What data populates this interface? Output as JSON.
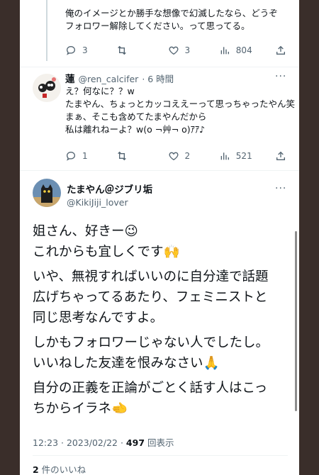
{
  "prev_tweet": {
    "text_lines": [
      "俺のイメージとか勝手な想像で幻滅したなら、どうぞ",
      "フォロワー解除してください。って思ってる。"
    ],
    "actions": {
      "replies": "3",
      "retweets": "",
      "likes": "3",
      "views": "804"
    }
  },
  "reply": {
    "display_name": "蓮",
    "handle": "@ren_calcifer",
    "time": "· 6 時間",
    "text_lines": [
      "え？何なに？？w",
      "たまやん、ちょっとカッコええーって思っちゃったやん笑",
      "まぁ、そこも含めてたまやんだから",
      "私は離れねーよ？w(o ¬艸¬ o)ｱｱ♪"
    ],
    "actions": {
      "replies": "1",
      "retweets": "",
      "likes": "2",
      "views": "521"
    }
  },
  "main_tweet": {
    "display_name": "たまやん＠ジブリ垢",
    "handle": "@KikiJiji_lover",
    "paragraphs": [
      [
        "姐さん、好きー😉",
        "これからも宜しくです🙌"
      ],
      [
        "いや、無視すればいいのに自分達で話題",
        "広げちゃってるあたり、フェミニストと",
        "同じ思考なんですよ。"
      ],
      [
        "しかもフォロワーじゃない人でしたし。",
        "いいねした友達を恨みなさい🙏"
      ],
      [
        "自分の正義を正論がごとく話す人はこっ",
        "ちからイラネ🫲"
      ]
    ],
    "timestamp": "12:23 · 2023/02/22 · ",
    "view_count": "497",
    "view_label": " 回表示",
    "likes_count": "2",
    "likes_label": " 件のいいね"
  },
  "colors": {
    "text": "#0f1419",
    "muted": "#536471",
    "background": "#ffffff",
    "frame": "#3a2e2a"
  },
  "icons": [
    "reply-icon",
    "retweet-icon",
    "like-icon",
    "views-icon",
    "share-icon",
    "more-icon"
  ]
}
